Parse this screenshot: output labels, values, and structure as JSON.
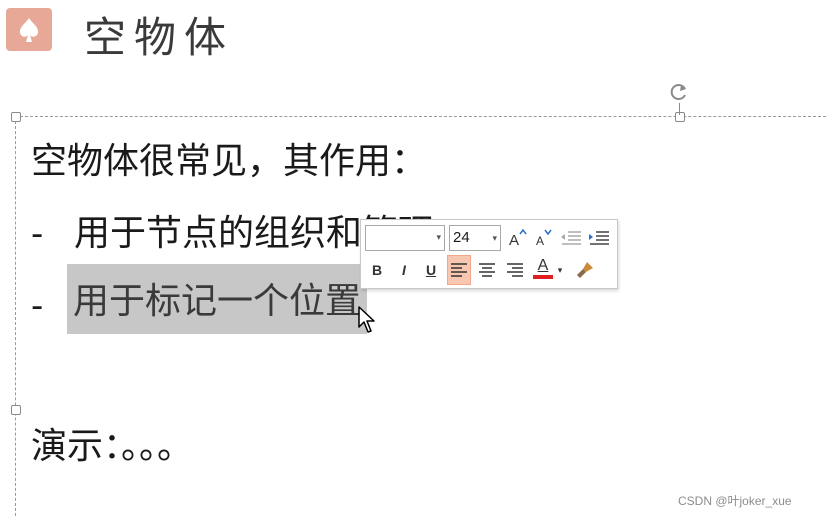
{
  "slide": {
    "title": "空物体",
    "lines": {
      "intro": "空物体很常见，其作用：",
      "bullet_marker": "-",
      "bullet1": "用于节点的组织和管理",
      "bullet2": "用于标记一个位置",
      "demo": "演示：。。。"
    }
  },
  "toolbar": {
    "font_name": "",
    "font_size": "24",
    "bold": "B",
    "italic": "I",
    "underline": "U",
    "font_color_label": "A",
    "font_color": "#e02020",
    "align_left_active": true
  },
  "watermark": "CSDN @叶joker_xue",
  "colors": {
    "title_icon": "#e8a898",
    "selection": "#c7c7c7",
    "active_button": "#f8c7b2"
  }
}
